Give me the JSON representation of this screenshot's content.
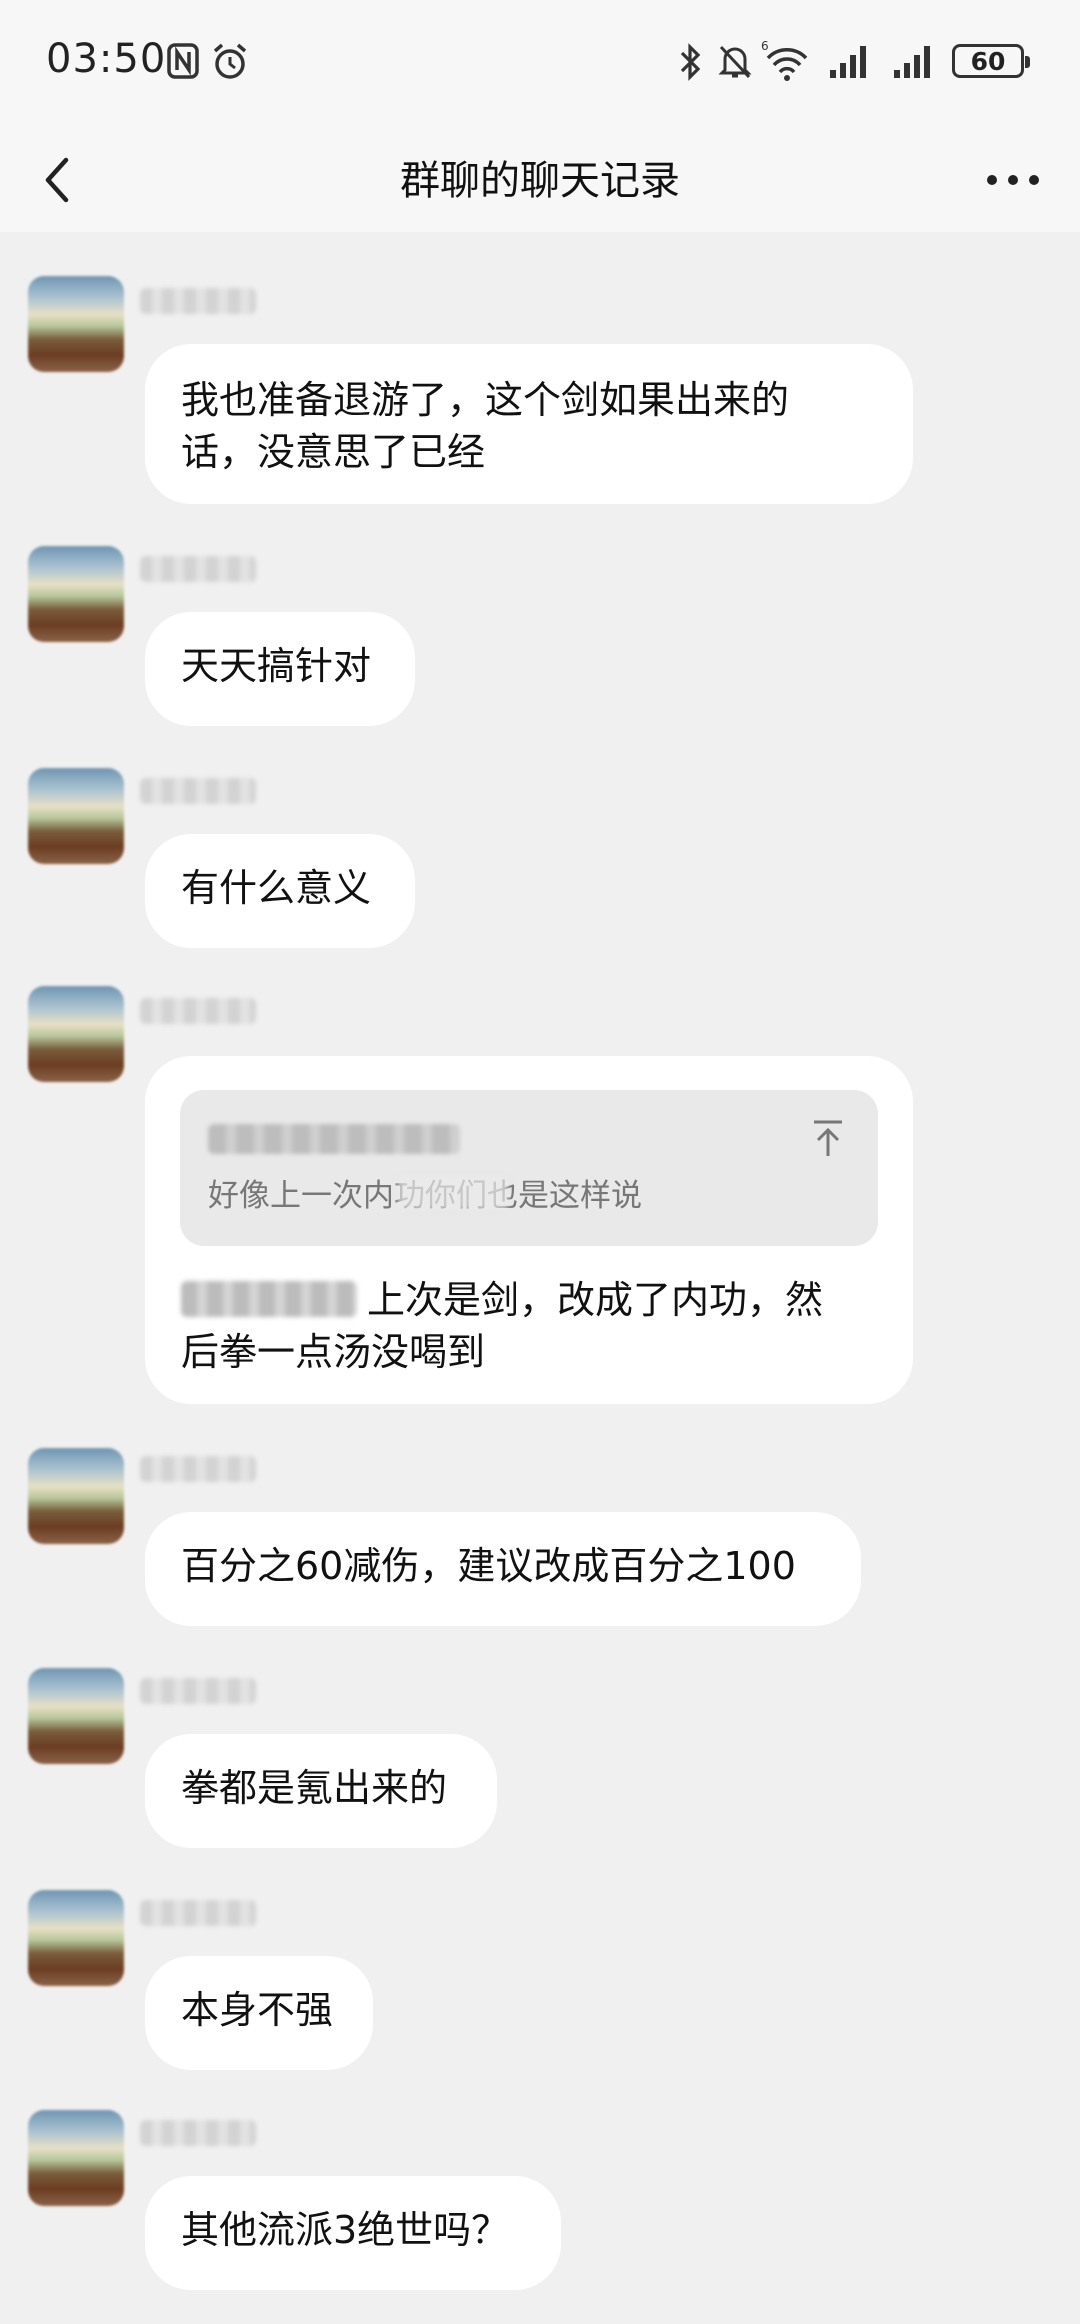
{
  "status_bar": {
    "time": "03:50",
    "battery": "60",
    "icons": [
      "nfc-icon",
      "alarm-icon",
      "bluetooth-icon",
      "mute-icon",
      "wifi-icon",
      "signal-icon",
      "signal-icon",
      "battery-icon"
    ]
  },
  "header": {
    "title": "群聊的聊天记录",
    "back_icon": "chevron-left-icon",
    "more_icon": "more-icon"
  },
  "messages": [
    {
      "text_line1": "我也准备退游了，这个剑如果出来的",
      "text_line2": "话，没意思了已经"
    },
    {
      "text": "天天搞针对"
    },
    {
      "text": "有什么意义"
    },
    {
      "quote": {
        "text": "好像上一次内功你们也是这样说"
      },
      "mention_suffix": "上次是剑，改成了内功，然",
      "text_line2": "后拳一点汤没喝到"
    },
    {
      "text": "百分之60减伤，建议改成百分之100"
    },
    {
      "text": "拳都是氪出来的"
    },
    {
      "text": "本身不强"
    },
    {
      "text": "其他流派3绝世吗？"
    }
  ]
}
